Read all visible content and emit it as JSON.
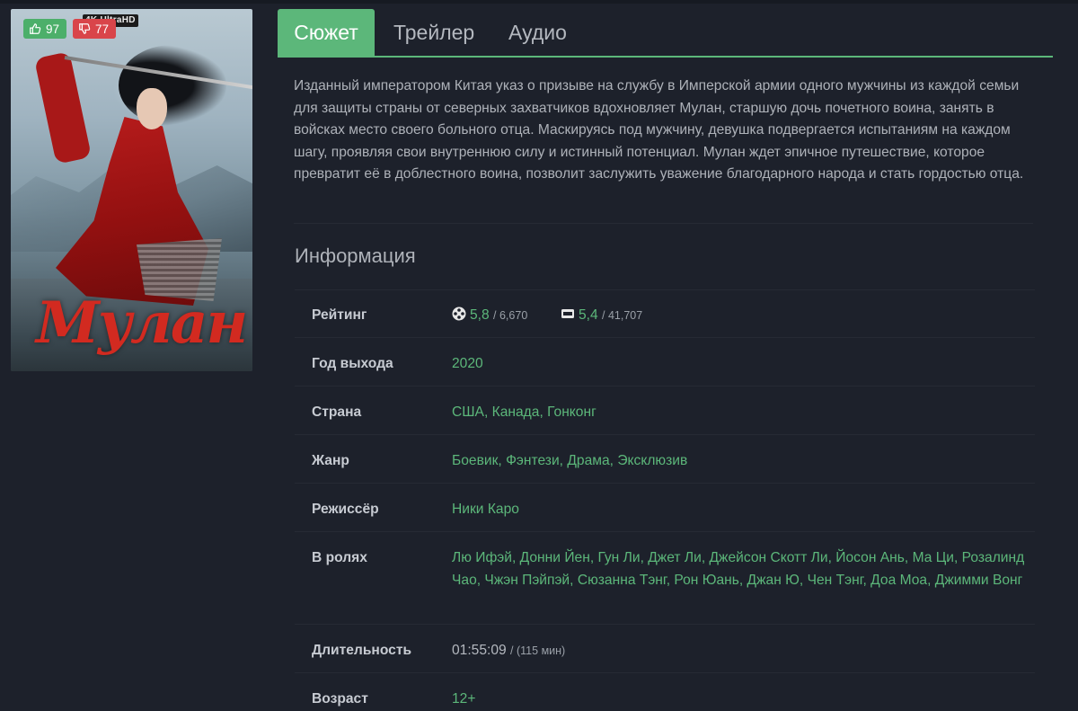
{
  "poster": {
    "title_art": "Мулан",
    "quality_badge": "4K UltraHD",
    "likes": "97",
    "dislikes": "77"
  },
  "tabs": [
    {
      "label": "Сюжет",
      "active": true
    },
    {
      "label": "Трейлер",
      "active": false
    },
    {
      "label": "Аудио",
      "active": false
    }
  ],
  "description": "Изданный императором Китая указ о призыве на службу в Имперской армии одного мужчины из каждой семьи для защиты страны от северных захватчиков вдохновляет Мулан, старшую дочь почетного воина, занять в войсках место своего больного отца. Маскируясь под мужчину, девушка подвергается испытаниям на каждом шагу, проявляя свои внутреннюю силу и истинный потенциал. Мулан ждет эпичное путешествие, которое превратит её в доблестного воина, позволит заслужить уважение благодарного народа и стать гордостью отца.",
  "info": {
    "title": "Информация",
    "rating": {
      "label": "Рейтинг",
      "kp_value": "5,8",
      "kp_votes": "6,670",
      "imdb_value": "5,4",
      "imdb_votes": "41,707",
      "kp_icon": "film-reel-icon",
      "imdb_icon": "imdb-icon"
    },
    "year": {
      "label": "Год выхода",
      "value": "2020"
    },
    "country": {
      "label": "Страна",
      "values": [
        "США",
        "Канада",
        "Гонконг"
      ]
    },
    "genre": {
      "label": "Жанр",
      "values": [
        "Боевик",
        "Фэнтези",
        "Драма",
        "Эксклюзив"
      ]
    },
    "director": {
      "label": "Режиссёр",
      "values": [
        "Ники Каро"
      ]
    },
    "cast": {
      "label": "В ролях",
      "values": [
        "Лю Ифэй",
        "Донни Йен",
        "Гун Ли",
        "Джет Ли",
        "Джейсон Скотт Ли",
        "Йосон Ань",
        "Ма Ци",
        "Розалинд Чао",
        "Чжэн Пэйпэй",
        "Сюзанна Тэнг",
        "Рон Юань",
        "Джан Ю",
        "Чен Тэнг",
        "Доа Моа",
        "Джимми Вонг"
      ]
    },
    "duration": {
      "label": "Длительность",
      "value": "01:55:09",
      "minutes": "(115 мин)"
    },
    "age": {
      "label": "Возраст",
      "value": "12+"
    }
  },
  "colors": {
    "accent": "#5cb77a",
    "background": "#1d212b",
    "like": "#4caf6a",
    "dislike": "#d9454a"
  }
}
